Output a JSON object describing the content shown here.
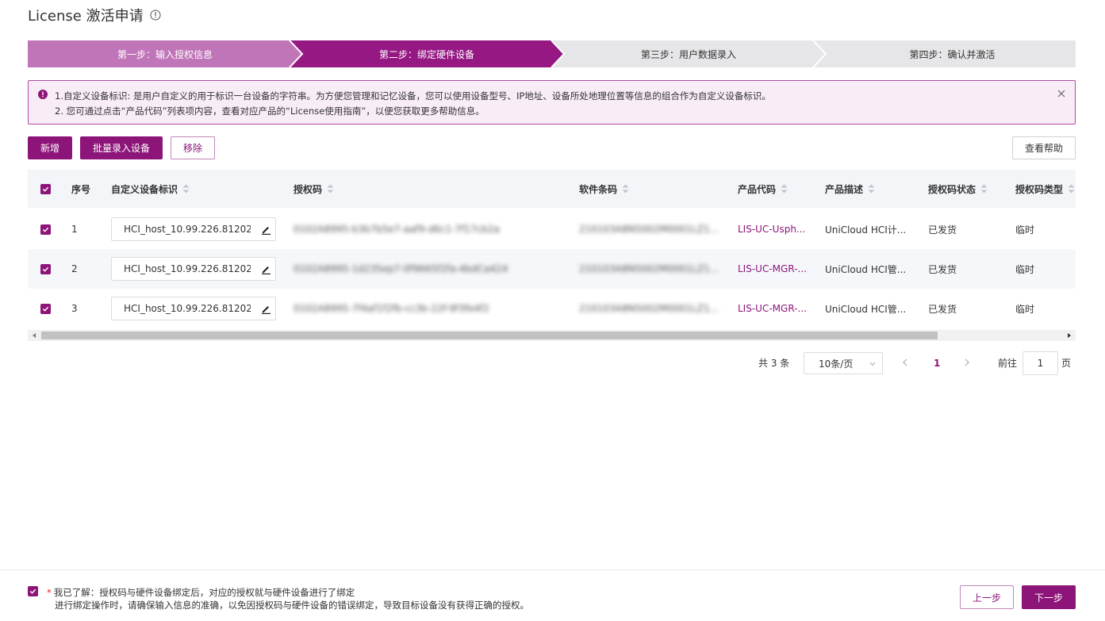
{
  "page": {
    "title": "License 激活申请"
  },
  "steps": [
    {
      "label": "第一步：输入授权信息",
      "state": "done"
    },
    {
      "label": "第二步：绑定硬件设备",
      "state": "active"
    },
    {
      "label": "第三步：用户数据录入",
      "state": "pending"
    },
    {
      "label": "第四步：确认并激活",
      "state": "pending"
    }
  ],
  "alert": {
    "line1": "1.自定义设备标识: 是用户自定义的用于标识一台设备的字符串。为方便您管理和记忆设备，您可以使用设备型号、IP地址、设备所处地理位置等信息的组合作为自定义设备标识。",
    "line2": "2. 您可通过点击“产品代码”列表项内容，查看对应产品的“License使用指南”，以便您获取更多帮助信息。"
  },
  "toolbar": {
    "add_label": "新增",
    "batch_label": "批量录入设备",
    "remove_label": "移除",
    "help_label": "查看帮助"
  },
  "table": {
    "headers": {
      "index": "序号",
      "device_id": "自定义设备标识",
      "auth_code": "授权码",
      "barcode": "软件条码",
      "product_code": "产品代码",
      "product_desc": "产品描述",
      "status": "授权码状态",
      "type": "授权码类型"
    },
    "rows": [
      {
        "index": "1",
        "device_id": "HCI_host_10.99.226.81202",
        "auth_code": "0102A8995-b3b7b5e7-aaf9-d6c1-7f17cb2a",
        "barcode": "210103A8N5002M0001LZ1...",
        "product_code": "LIS-UC-Usph...",
        "product_desc": "UniCloud HCI计...",
        "status": "已发货",
        "type": "临时"
      },
      {
        "index": "2",
        "device_id": "HCI_host_10.99.226.81202",
        "auth_code": "0102A8995-1d235ep7-0f9665f2fa-4bdCa424",
        "barcode": "210103A8N5002M0001LZ1...",
        "product_code": "LIS-UC-MGR-...",
        "product_desc": "UniCloud HCI管...",
        "status": "已发货",
        "type": "临时"
      },
      {
        "index": "3",
        "device_id": "HCI_host_10.99.226.81202",
        "auth_code": "0102A8995-7f4af1f2fb-cc3b-22f-9f3fe4f2",
        "barcode": "210103A8N5002M0001LZ1...",
        "product_code": "LIS-UC-MGR-...",
        "product_desc": "UniCloud HCI管...",
        "status": "已发货",
        "type": "临时"
      }
    ]
  },
  "pagination": {
    "total_label": "共 3 条",
    "page_size": "10条/页",
    "current_page": "1",
    "goto_label": "前往",
    "goto_value": "1",
    "page_unit": "页"
  },
  "footer": {
    "star": "*",
    "line1": "我已了解：授权码与硬件设备绑定后，对应的授权就与硬件设备进行了绑定",
    "line2": "进行绑定操作时，请确保输入信息的准确，以免因授权码与硬件设备的错误绑定，导致目标设备没有获得正确的授权。",
    "prev_label": "上一步",
    "next_label": "下一步"
  },
  "colors": {
    "accent": "#8d1478",
    "step_done": "#c075b8",
    "step_active": "#951883",
    "step_pending": "#e6e6e8",
    "alert_bg": "#f8ecf6"
  }
}
